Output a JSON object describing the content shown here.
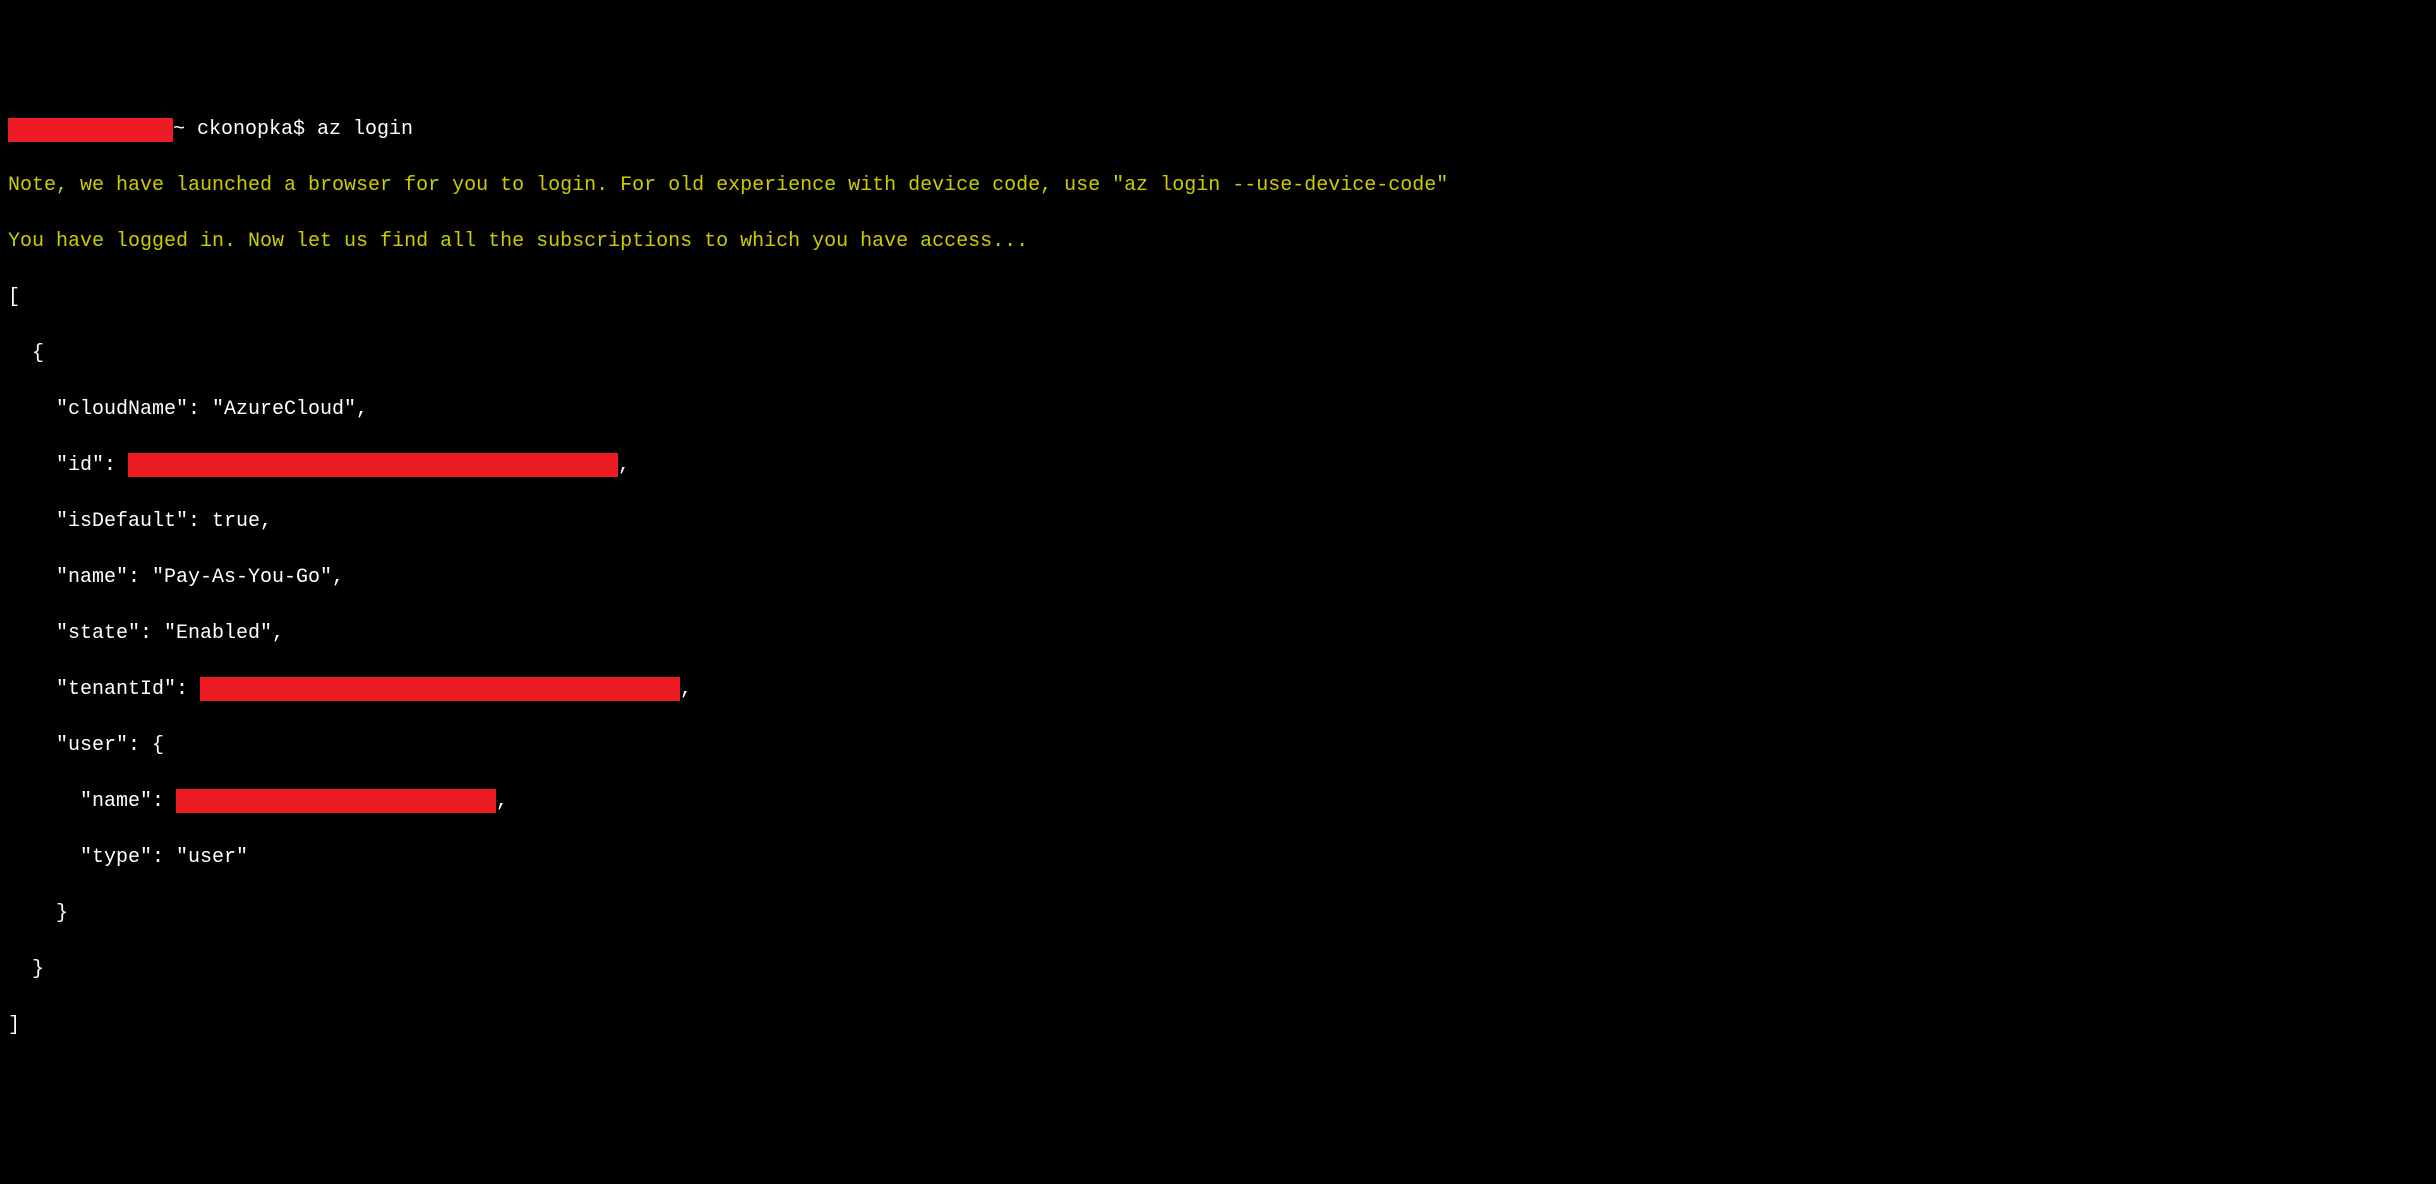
{
  "prompt": {
    "separator": "~ ",
    "user": "ckonopka$ ",
    "command": "az login"
  },
  "messages": {
    "note": "Note, we have launched a browser for you to login. For old experience with device code, use \"az login --use-device-code\"",
    "loggedIn": "You have logged in. Now let us find all the subscriptions to which you have access..."
  },
  "json": {
    "openBracket": "[",
    "openBrace": "  {",
    "cloudName": "    \"cloudName\": \"AzureCloud\",",
    "idKey": "    \"id\": ",
    "idComma": ",",
    "isDefault": "    \"isDefault\": true,",
    "name": "    \"name\": \"Pay-As-You-Go\",",
    "state": "    \"state\": \"Enabled\",",
    "tenantKey": "    \"tenantId\": ",
    "tenantComma": ",",
    "userOpen": "    \"user\": {",
    "userNameKey": "      \"name\": ",
    "userNameComma": ",",
    "userType": "      \"type\": \"user\"",
    "userClose": "    }",
    "closeBrace": "  }",
    "closeBracket": "]"
  }
}
